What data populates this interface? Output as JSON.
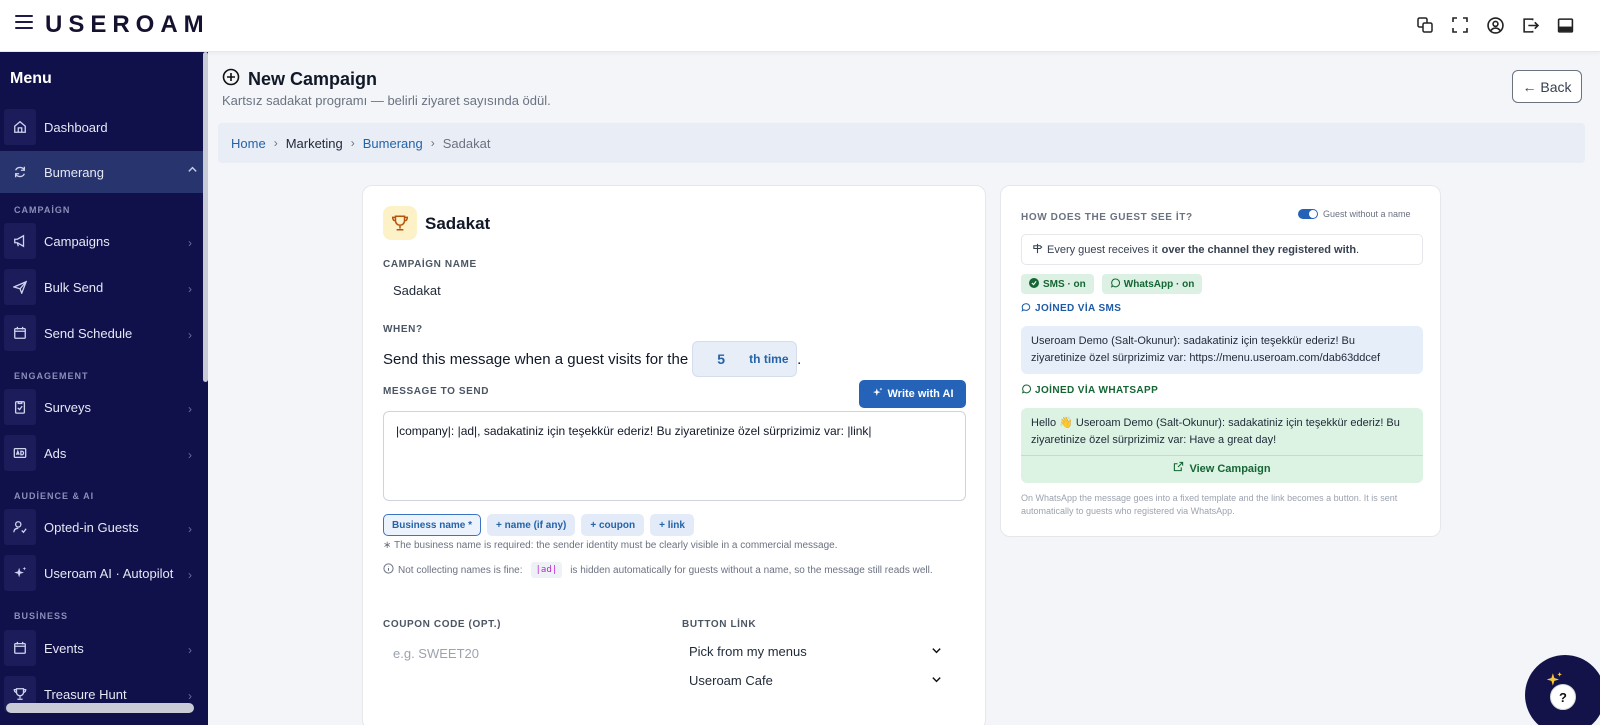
{
  "app": {
    "logo": "USEROAM"
  },
  "sidebar": {
    "menu_title": "Menu",
    "items": {
      "dashboard": "Dashboard",
      "bumerang": "Bumerang",
      "campaigns": "Campaigns",
      "bulk_send": "Bulk Send",
      "send_schedule": "Send Schedule",
      "surveys": "Surveys",
      "ads": "Ads",
      "opted_in": "Opted-in Guests",
      "autopilot": "Useroam AI · Autopilot",
      "events": "Events",
      "treasure_hunt": "Treasure Hunt"
    },
    "sections": {
      "campaign": "CAMPAİGN",
      "engagement": "ENGAGEMENT",
      "audience": "AUDİENCE & AI",
      "business": "BUSİNESS"
    }
  },
  "page": {
    "title": "New Campaign",
    "subtitle": "Kartsız sadakat programı — belirli ziyaret sayısında ödül.",
    "back": "← Back"
  },
  "breadcrumb": {
    "home": "Home",
    "marketing": "Marketing",
    "bumerang": "Bumerang",
    "current": "Sadakat"
  },
  "form": {
    "title": "Sadakat",
    "name_label": "CAMPAİGN NAME",
    "name_value": "Sadakat",
    "when_label": "WHEN?",
    "when_text": "Send this message when a guest visits for the",
    "visit_count": "5",
    "visit_suffix": "th time",
    "when_end": ".",
    "message_label": "MESSAGE TO SEND",
    "ai_button": "Write with AI",
    "message": "|company|: |ad|, sadakatiniz için teşekkür ederiz! Bu ziyaretinize özel sürprizimiz var: |link|",
    "chips": {
      "business": "Business name *",
      "name": "+ name (if any)",
      "coupon": "+ coupon",
      "link": "+ link"
    },
    "note1": "∗ The business name is required: the sender identity must be clearly visible in a commercial message.",
    "note2_a": "Not collecting names is fine:",
    "note2_code": "|ad|",
    "note2_b": "is hidden automatically for guests without a name, so the message still reads well.",
    "coupon_label": "COUPON CODE (OPT.)",
    "coupon_placeholder": "e.g. SWEET20",
    "button_label": "BUTTON LİNK",
    "select1": "Pick from my menus",
    "select2": "Useroam Cafe"
  },
  "preview": {
    "heading": "HOW DOES THE GUEST SEE İT?",
    "toggle_label": "Guest without a name",
    "info_a": "Every guest receives it",
    "info_b": "over the channel they registered with",
    "info_c": ".",
    "badge_sms": "SMS · on",
    "badge_wa": "WhatsApp · on",
    "sms_title": "JOİNED VİA SMS",
    "sms_text": "Useroam Demo (Salt-Okunur): sadakatiniz için teşekkür ederiz! Bu ziyaretinize özel sürprizimiz var: https://menu.useroam.com/dab63ddcef",
    "wa_title": "JOİNED VİA WHATSAPP",
    "wa_text": "Hello 👋 Useroam Demo (Salt-Okunur): sadakatiniz için teşekkür ederiz! Bu ziyaretinize özel sürprizimiz var: Have a great day!",
    "wa_link": "View Campaign",
    "footer": "On WhatsApp the message goes into a fixed template and the link becomes a button. It is sent automatically to guests who registered via WhatsApp."
  },
  "fab": {
    "help": "?"
  }
}
